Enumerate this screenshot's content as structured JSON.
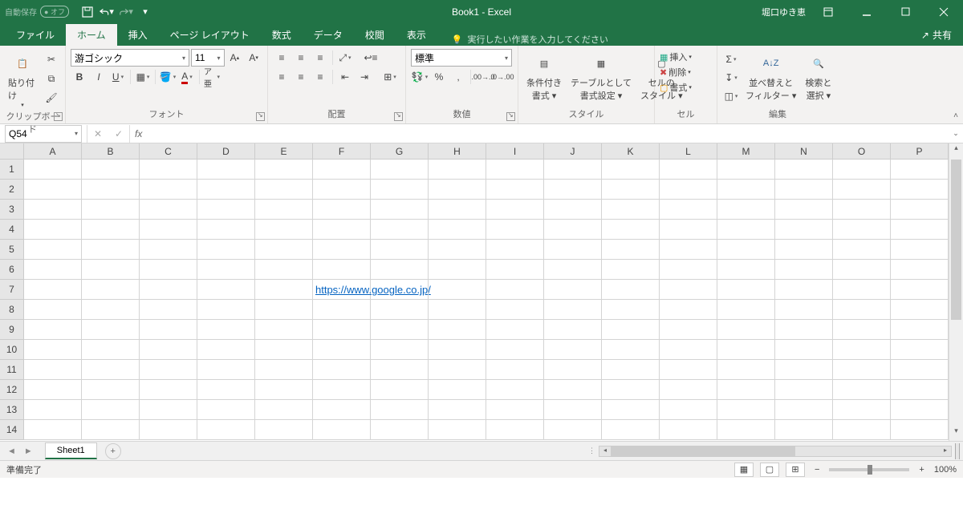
{
  "titlebar": {
    "autosave_label": "自動保存",
    "autosave_state": "オフ",
    "doc_title": "Book1 - Excel",
    "user": "堀口ゆき恵"
  },
  "tabs": {
    "file": "ファイル",
    "home": "ホーム",
    "insert": "挿入",
    "pagelayout": "ページ レイアウト",
    "formulas": "数式",
    "data": "データ",
    "review": "校閲",
    "view": "表示",
    "tellme": "実行したい作業を入力してください",
    "share": "共有"
  },
  "ribbon": {
    "clipboard": {
      "label": "クリップボード",
      "paste": "貼り付け"
    },
    "font": {
      "label": "フォント",
      "name": "游ゴシック",
      "size": "11"
    },
    "align": {
      "label": "配置"
    },
    "number": {
      "label": "数値",
      "format": "標準"
    },
    "styles": {
      "label": "スタイル",
      "cond": "条件付き\n書式 ▾",
      "table": "テーブルとして\n書式設定 ▾",
      "cell": "セルの\nスタイル ▾"
    },
    "cells": {
      "label": "セル",
      "insert": "挿入",
      "delete": "削除",
      "format": "書式"
    },
    "editing": {
      "label": "編集",
      "sort": "並べ替えと\nフィルター ▾",
      "find": "検索と\n選択 ▾"
    }
  },
  "formula_bar": {
    "cell_ref": "Q54",
    "formula": ""
  },
  "grid": {
    "columns": [
      "A",
      "B",
      "C",
      "D",
      "E",
      "F",
      "G",
      "H",
      "I",
      "J",
      "K",
      "L",
      "M",
      "N",
      "O",
      "P"
    ],
    "rows": [
      "1",
      "2",
      "3",
      "4",
      "5",
      "6",
      "7",
      "8",
      "9",
      "10",
      "11",
      "12",
      "13",
      "14"
    ],
    "link_cell": {
      "row": 7,
      "col": "F",
      "text": "https://www.google.co.jp/"
    }
  },
  "sheets": {
    "sheet1": "Sheet1"
  },
  "status": {
    "ready": "準備完了",
    "zoom": "100%"
  }
}
